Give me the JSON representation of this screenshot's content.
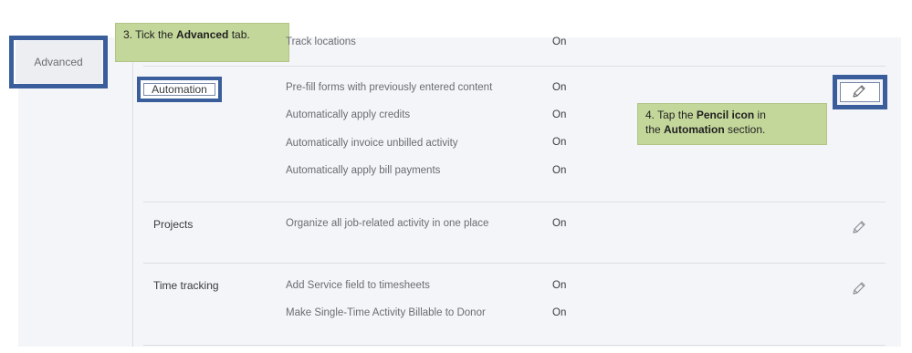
{
  "sidebar": {
    "advanced_tab": "Advanced"
  },
  "callouts": {
    "step3": {
      "prefix": "3. Tick the ",
      "bold": "Advanced",
      "suffix": " tab."
    },
    "step4": {
      "line1_prefix": "4. Tap the ",
      "line1_bold": "Pencil icon",
      "line1_suffix": " in",
      "line2_prefix": "the ",
      "line2_bold": "Automation",
      "line2_suffix": " section."
    }
  },
  "sections": {
    "top_partial": {
      "rows": [
        {
          "text": "Track locations",
          "value": "On"
        }
      ]
    },
    "automation": {
      "label": "Automation",
      "rows": [
        {
          "text": "Pre-fill forms with previously entered content",
          "value": "On"
        },
        {
          "text": "Automatically apply credits",
          "value": "On"
        },
        {
          "text": "Automatically invoice unbilled activity",
          "value": "On"
        },
        {
          "text": "Automatically apply bill payments",
          "value": "On"
        }
      ]
    },
    "projects": {
      "label": "Projects",
      "rows": [
        {
          "text": "Organize all job-related activity in one place",
          "value": "On"
        }
      ]
    },
    "time_tracking": {
      "label": "Time tracking",
      "rows": [
        {
          "text": "Add Service field to timesheets",
          "value": "On"
        },
        {
          "text": "Make Single-Time Activity Billable to Donor",
          "value": "On"
        }
      ]
    }
  },
  "colors": {
    "highlight": "#3a5e9c",
    "callout_bg": "#c4d79b",
    "panel_bg": "#f4f5f8"
  },
  "icons": {
    "edit": "pencil-icon"
  }
}
